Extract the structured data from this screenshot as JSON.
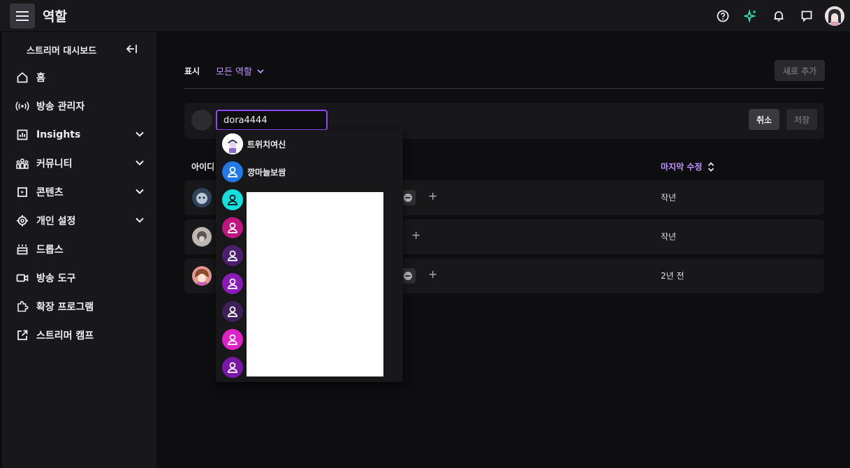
{
  "header": {
    "title": "역할",
    "icons": [
      "menu-icon",
      "help-icon",
      "sparkle-icon",
      "bell-icon",
      "chat-icon",
      "avatar"
    ]
  },
  "sidebar": {
    "title": "스트리머 대시보드",
    "items": [
      {
        "label": "홈",
        "icon": "home-icon",
        "expandable": false
      },
      {
        "label": "방송 관리자",
        "icon": "broadcast-icon",
        "expandable": false
      },
      {
        "label": "Insights",
        "icon": "insights-icon",
        "expandable": true
      },
      {
        "label": "커뮤니티",
        "icon": "community-icon",
        "expandable": true
      },
      {
        "label": "콘텐츠",
        "icon": "content-icon",
        "expandable": true
      },
      {
        "label": "개인 설정",
        "icon": "settings-icon",
        "expandable": true
      },
      {
        "label": "드롭스",
        "icon": "drops-icon",
        "expandable": false
      },
      {
        "label": "방송 도구",
        "icon": "camera-icon",
        "expandable": false
      },
      {
        "label": "확장 프로그램",
        "icon": "extension-icon",
        "expandable": false
      },
      {
        "label": "스트리머 캠프",
        "icon": "external-link-icon",
        "expandable": false
      }
    ]
  },
  "main": {
    "filter_label": "표시",
    "filter_value": "모든 역할",
    "add_button": "새로 추가",
    "search_value": "dora4444",
    "cancel_button": "취소",
    "save_button": "저장",
    "column_id": "아이디",
    "column_modified": "마지막 수정",
    "rows": [
      {
        "time": "작년"
      },
      {
        "time": "작년"
      },
      {
        "time": "2년 전"
      }
    ]
  },
  "dropdown": {
    "items": [
      {
        "name": "트위치여신",
        "color": "#ffffff"
      },
      {
        "name": "깡마늘보쌈",
        "color": "#1f7ae8"
      },
      {
        "name": "",
        "color": "#14dfdf"
      },
      {
        "name": "",
        "color": "#c0147f"
      },
      {
        "name": "",
        "color": "#4b1f6d"
      },
      {
        "name": "",
        "color": "#8a1bb8"
      },
      {
        "name": "",
        "color": "#3d1f5a"
      },
      {
        "name": "",
        "color": "#e021c8"
      },
      {
        "name": "",
        "color": "#7a16a8"
      }
    ]
  },
  "colors": {
    "accent": "#9147ff",
    "accent_text": "#bf94ff",
    "background": "#0e0e10",
    "surface": "#18181b"
  }
}
